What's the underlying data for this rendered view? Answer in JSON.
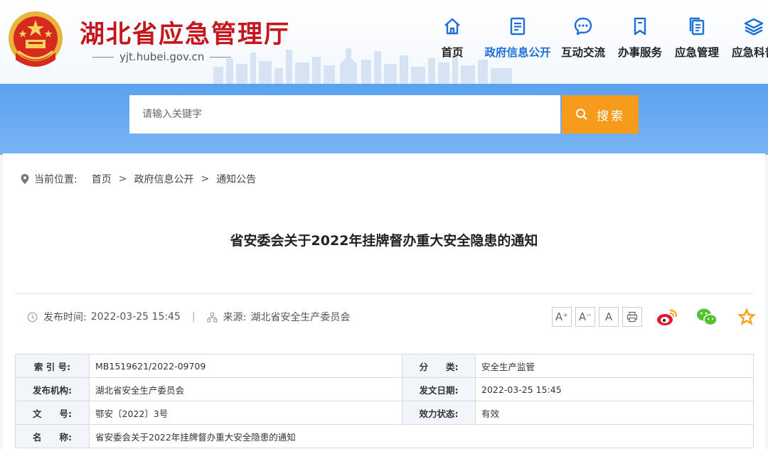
{
  "header": {
    "site_title": "湖北省应急管理厅",
    "site_domain": "yjt.hubei.gov.cn",
    "nav": [
      {
        "label": "首页",
        "icon": "home-icon"
      },
      {
        "label": "政府信息公开",
        "icon": "document-icon",
        "active": true
      },
      {
        "label": "互动交流",
        "icon": "chat-icon"
      },
      {
        "label": "办事服务",
        "icon": "bookmark-icon"
      },
      {
        "label": "应急管理",
        "icon": "files-icon"
      },
      {
        "label": "应急科普",
        "icon": "layers-icon"
      }
    ]
  },
  "search": {
    "placeholder": "请输入关键字",
    "button_label": "搜索"
  },
  "breadcrumb": {
    "prefix": "当前位置:",
    "items": [
      "首页",
      "政府信息公开",
      "通知公告"
    ]
  },
  "article": {
    "title": "省安委会关于2022年挂牌督办重大安全隐患的通知",
    "publish_label": "发布时间:",
    "publish_time": "2022-03-25 15:45",
    "source_label": "来源:",
    "source": "湖北省安全生产委员会",
    "tools": [
      "A⁺",
      "A⁻",
      "A"
    ]
  },
  "info_table": {
    "index_label": "索 引 号:",
    "index_value": "MB1519621/2022-09709",
    "category_label": "分　　类:",
    "category_value": "安全生产监管",
    "issuer_label": "发布机构:",
    "issuer_value": "湖北省安全生产委员会",
    "date_label": "发文日期:",
    "date_value": "2022-03-25 15:45",
    "docno_label": "文　　号:",
    "docno_value": "鄂安〔2022〕3号",
    "status_label": "效力状态:",
    "status_value": "有效",
    "name_label": "名　　称:",
    "name_value": "省安委会关于2022年挂牌督办重大安全隐患的通知"
  },
  "colors": {
    "title_red": "#c4161c",
    "nav_active": "#1c6fd8",
    "search_button": "#f69b1c",
    "band_blue": "#5aa2ef"
  }
}
